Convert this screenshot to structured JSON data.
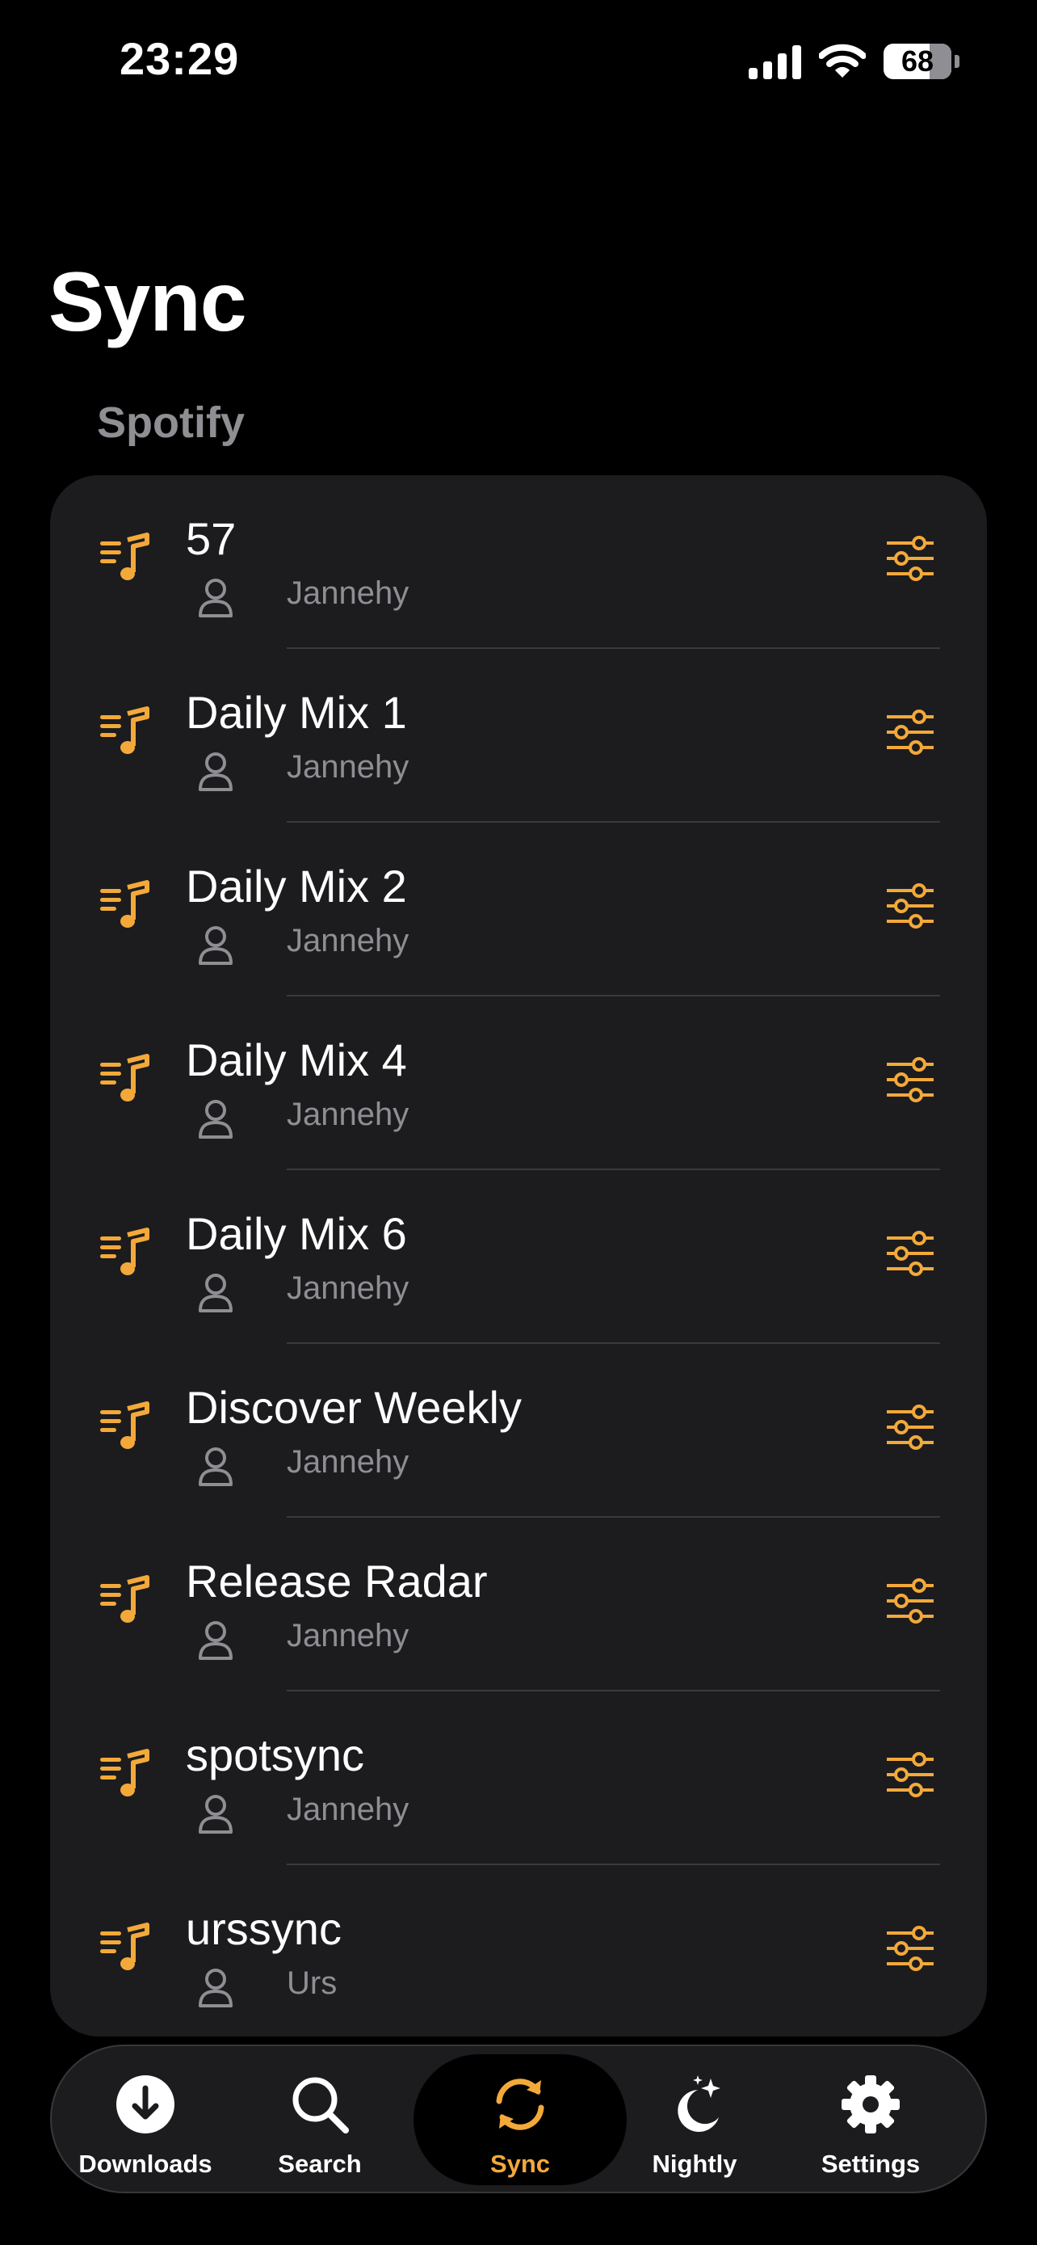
{
  "status_bar": {
    "time": "23:29",
    "battery_percent": "68",
    "battery_level": 0.68
  },
  "page": {
    "title": "Sync"
  },
  "section": {
    "header": "Spotify"
  },
  "playlists": [
    {
      "name": "57",
      "owner": "Jannehy"
    },
    {
      "name": "Daily Mix 1",
      "owner": "Jannehy"
    },
    {
      "name": "Daily Mix 2",
      "owner": "Jannehy"
    },
    {
      "name": "Daily Mix 4",
      "owner": "Jannehy"
    },
    {
      "name": "Daily Mix 6",
      "owner": "Jannehy"
    },
    {
      "name": "Discover Weekly",
      "owner": "Jannehy"
    },
    {
      "name": "Release Radar",
      "owner": "Jannehy"
    },
    {
      "name": "spotsync",
      "owner": "Jannehy"
    },
    {
      "name": "urssync",
      "owner": "Urs"
    }
  ],
  "tabbar": {
    "tabs": [
      {
        "label": "Downloads",
        "icon": "download-circle-icon"
      },
      {
        "label": "Search",
        "icon": "magnifying-glass-icon"
      },
      {
        "label": "Sync",
        "icon": "sync-arrows-icon",
        "active": true
      },
      {
        "label": "Nightly",
        "icon": "moon-stars-icon"
      },
      {
        "label": "Settings",
        "icon": "gear-icon"
      }
    ]
  },
  "colors": {
    "accent": "#f3a93a",
    "background": "#000000",
    "card": "#1c1c1e",
    "secondary_text": "#8e8e93"
  }
}
